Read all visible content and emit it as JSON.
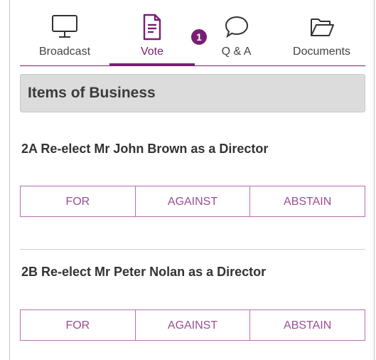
{
  "tabs": [
    {
      "label": "Broadcast",
      "icon": "monitor-icon"
    },
    {
      "label": "Vote",
      "icon": "document-icon",
      "active": true,
      "badge": "1"
    },
    {
      "label": "Q & A",
      "icon": "speech-bubble-icon"
    },
    {
      "label": "Documents",
      "icon": "folder-icon"
    }
  ],
  "section": {
    "title": "Items of Business"
  },
  "resolutions": [
    {
      "title": "2A Re-elect Mr John Brown as a Director",
      "options": [
        "FOR",
        "AGAINST",
        "ABSTAIN"
      ]
    },
    {
      "title": "2B Re-elect Mr Peter Nolan as a Director",
      "options": [
        "FOR",
        "AGAINST",
        "ABSTAIN"
      ]
    }
  ],
  "colors": {
    "accent": "#7a1e73",
    "button_border": "#b56fae",
    "button_text": "#9b4d93",
    "header_bg": "#dcdcdc"
  }
}
